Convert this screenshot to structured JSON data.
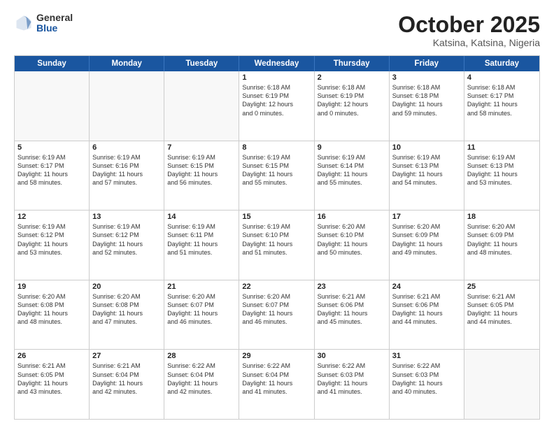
{
  "logo": {
    "general": "General",
    "blue": "Blue"
  },
  "title": {
    "month": "October 2025",
    "location": "Katsina, Katsina, Nigeria"
  },
  "calendar": {
    "headers": [
      "Sunday",
      "Monday",
      "Tuesday",
      "Wednesday",
      "Thursday",
      "Friday",
      "Saturday"
    ],
    "weeks": [
      [
        {
          "day": "",
          "info": ""
        },
        {
          "day": "",
          "info": ""
        },
        {
          "day": "",
          "info": ""
        },
        {
          "day": "1",
          "info": "Sunrise: 6:18 AM\nSunset: 6:19 PM\nDaylight: 12 hours\nand 0 minutes."
        },
        {
          "day": "2",
          "info": "Sunrise: 6:18 AM\nSunset: 6:19 PM\nDaylight: 12 hours\nand 0 minutes."
        },
        {
          "day": "3",
          "info": "Sunrise: 6:18 AM\nSunset: 6:18 PM\nDaylight: 11 hours\nand 59 minutes."
        },
        {
          "day": "4",
          "info": "Sunrise: 6:18 AM\nSunset: 6:17 PM\nDaylight: 11 hours\nand 58 minutes."
        }
      ],
      [
        {
          "day": "5",
          "info": "Sunrise: 6:19 AM\nSunset: 6:17 PM\nDaylight: 11 hours\nand 58 minutes."
        },
        {
          "day": "6",
          "info": "Sunrise: 6:19 AM\nSunset: 6:16 PM\nDaylight: 11 hours\nand 57 minutes."
        },
        {
          "day": "7",
          "info": "Sunrise: 6:19 AM\nSunset: 6:15 PM\nDaylight: 11 hours\nand 56 minutes."
        },
        {
          "day": "8",
          "info": "Sunrise: 6:19 AM\nSunset: 6:15 PM\nDaylight: 11 hours\nand 55 minutes."
        },
        {
          "day": "9",
          "info": "Sunrise: 6:19 AM\nSunset: 6:14 PM\nDaylight: 11 hours\nand 55 minutes."
        },
        {
          "day": "10",
          "info": "Sunrise: 6:19 AM\nSunset: 6:13 PM\nDaylight: 11 hours\nand 54 minutes."
        },
        {
          "day": "11",
          "info": "Sunrise: 6:19 AM\nSunset: 6:13 PM\nDaylight: 11 hours\nand 53 minutes."
        }
      ],
      [
        {
          "day": "12",
          "info": "Sunrise: 6:19 AM\nSunset: 6:12 PM\nDaylight: 11 hours\nand 53 minutes."
        },
        {
          "day": "13",
          "info": "Sunrise: 6:19 AM\nSunset: 6:12 PM\nDaylight: 11 hours\nand 52 minutes."
        },
        {
          "day": "14",
          "info": "Sunrise: 6:19 AM\nSunset: 6:11 PM\nDaylight: 11 hours\nand 51 minutes."
        },
        {
          "day": "15",
          "info": "Sunrise: 6:19 AM\nSunset: 6:10 PM\nDaylight: 11 hours\nand 51 minutes."
        },
        {
          "day": "16",
          "info": "Sunrise: 6:20 AM\nSunset: 6:10 PM\nDaylight: 11 hours\nand 50 minutes."
        },
        {
          "day": "17",
          "info": "Sunrise: 6:20 AM\nSunset: 6:09 PM\nDaylight: 11 hours\nand 49 minutes."
        },
        {
          "day": "18",
          "info": "Sunrise: 6:20 AM\nSunset: 6:09 PM\nDaylight: 11 hours\nand 48 minutes."
        }
      ],
      [
        {
          "day": "19",
          "info": "Sunrise: 6:20 AM\nSunset: 6:08 PM\nDaylight: 11 hours\nand 48 minutes."
        },
        {
          "day": "20",
          "info": "Sunrise: 6:20 AM\nSunset: 6:08 PM\nDaylight: 11 hours\nand 47 minutes."
        },
        {
          "day": "21",
          "info": "Sunrise: 6:20 AM\nSunset: 6:07 PM\nDaylight: 11 hours\nand 46 minutes."
        },
        {
          "day": "22",
          "info": "Sunrise: 6:20 AM\nSunset: 6:07 PM\nDaylight: 11 hours\nand 46 minutes."
        },
        {
          "day": "23",
          "info": "Sunrise: 6:21 AM\nSunset: 6:06 PM\nDaylight: 11 hours\nand 45 minutes."
        },
        {
          "day": "24",
          "info": "Sunrise: 6:21 AM\nSunset: 6:06 PM\nDaylight: 11 hours\nand 44 minutes."
        },
        {
          "day": "25",
          "info": "Sunrise: 6:21 AM\nSunset: 6:05 PM\nDaylight: 11 hours\nand 44 minutes."
        }
      ],
      [
        {
          "day": "26",
          "info": "Sunrise: 6:21 AM\nSunset: 6:05 PM\nDaylight: 11 hours\nand 43 minutes."
        },
        {
          "day": "27",
          "info": "Sunrise: 6:21 AM\nSunset: 6:04 PM\nDaylight: 11 hours\nand 42 minutes."
        },
        {
          "day": "28",
          "info": "Sunrise: 6:22 AM\nSunset: 6:04 PM\nDaylight: 11 hours\nand 42 minutes."
        },
        {
          "day": "29",
          "info": "Sunrise: 6:22 AM\nSunset: 6:04 PM\nDaylight: 11 hours\nand 41 minutes."
        },
        {
          "day": "30",
          "info": "Sunrise: 6:22 AM\nSunset: 6:03 PM\nDaylight: 11 hours\nand 41 minutes."
        },
        {
          "day": "31",
          "info": "Sunrise: 6:22 AM\nSunset: 6:03 PM\nDaylight: 11 hours\nand 40 minutes."
        },
        {
          "day": "",
          "info": ""
        }
      ]
    ]
  }
}
